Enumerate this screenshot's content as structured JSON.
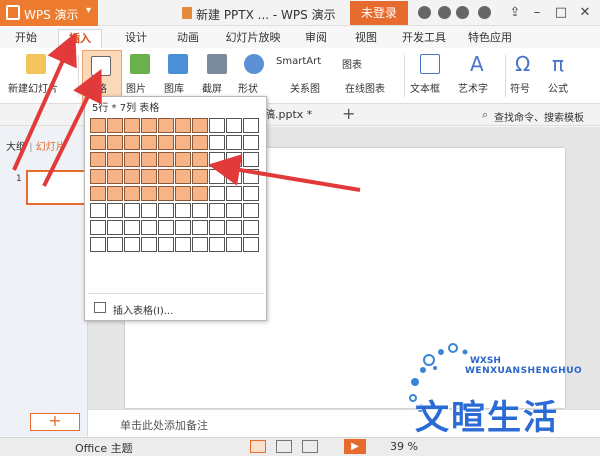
{
  "title_bar": {
    "app_name": "WPS 演示",
    "document_title": "新建 PPTX ... - WPS 演示",
    "login_button": "未登录"
  },
  "menu_tabs": [
    "开始",
    "插入",
    "设计",
    "动画",
    "幻灯片放映",
    "审阅",
    "视图",
    "开发工具",
    "特色应用"
  ],
  "active_tab": "插入",
  "ribbon": {
    "new_slide": "新建幻灯片",
    "table": "表格",
    "picture": "图片",
    "gallery": "图库",
    "screenshot": "截屏",
    "shape": "形状",
    "smartart": "SmartArt",
    "chart": "图表",
    "relation": "关系图",
    "online_chart": "在线图表",
    "textbox": "文本框",
    "wordart": "艺术字",
    "symbol": "符号",
    "formula": "公式"
  },
  "quick_bar": {
    "doc_tab": "稿.pptx *",
    "search": "查找命令、搜索模板"
  },
  "left_panel": {
    "outline_tab": "大纲",
    "slides_tab": "幻灯片",
    "slide_number": "1",
    "add_button": "+"
  },
  "table_dropdown": {
    "header": "5行 * 7列 表格",
    "rows": 8,
    "cols": 10,
    "selected_rows": 5,
    "selected_cols": 7,
    "insert_table": "插入表格(I)..."
  },
  "notes_placeholder": "单击此处添加备注",
  "status_bar": {
    "theme": "Office 主题",
    "zoom": "39 %"
  },
  "watermark": {
    "sub": "WXSH",
    "latin": "WENXUANSHENGHUO",
    "chinese": "文暄生活"
  },
  "colors": {
    "accent": "#e56b2f",
    "selected_cell": "#f7b486",
    "arrow": "#e23a3a"
  }
}
